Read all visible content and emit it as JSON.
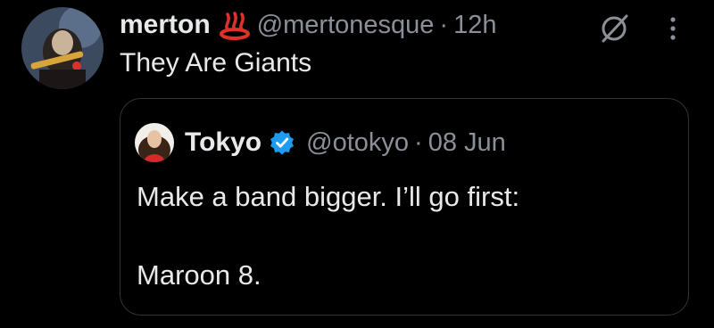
{
  "post": {
    "author": {
      "display_name": "merton",
      "emoji_icon": "hot-springs-emoji",
      "handle": "@mertonesque",
      "separator": "·",
      "time": "12h"
    },
    "text": "They Are Giants",
    "actions": {
      "grok_icon": "grok-icon",
      "more_icon": "more-vertical-icon"
    }
  },
  "quote": {
    "author": {
      "display_name": "Tokyo",
      "verified_icon": "verified-badge-icon",
      "handle": "@otokyo",
      "separator": "·",
      "time": "08 Jun"
    },
    "line1": "Make a band bigger. I’ll go first:",
    "line2": "Maroon 8."
  },
  "colors": {
    "background": "#000000",
    "text_primary": "#e7e9ea",
    "text_secondary": "#8b9098",
    "border": "#2f3336",
    "verified_blue": "#1d9bf0",
    "emoji_red": "#e0302a"
  }
}
